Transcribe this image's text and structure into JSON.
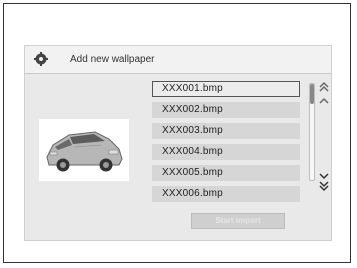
{
  "header": {
    "title": "Add new wallpaper"
  },
  "files": [
    {
      "name": "XXX001.bmp",
      "selected": true
    },
    {
      "name": "XXX002.bmp",
      "selected": false
    },
    {
      "name": "XXX003.bmp",
      "selected": false
    },
    {
      "name": "XXX004.bmp",
      "selected": false
    },
    {
      "name": "XXX005.bmp",
      "selected": false
    },
    {
      "name": "XXX006.bmp",
      "selected": false
    }
  ],
  "actions": {
    "start_import_label": "Start import"
  },
  "icons": {
    "settings": "gear-icon",
    "scroll_top": "double-chevron-up-icon",
    "scroll_up": "chevron-up-icon",
    "scroll_down": "chevron-down-icon",
    "scroll_bottom": "double-chevron-down-icon"
  },
  "colors": {
    "panel_bg": "#e9e9e9",
    "item_bg": "#d6d6d6",
    "selected_border": "#555555"
  }
}
